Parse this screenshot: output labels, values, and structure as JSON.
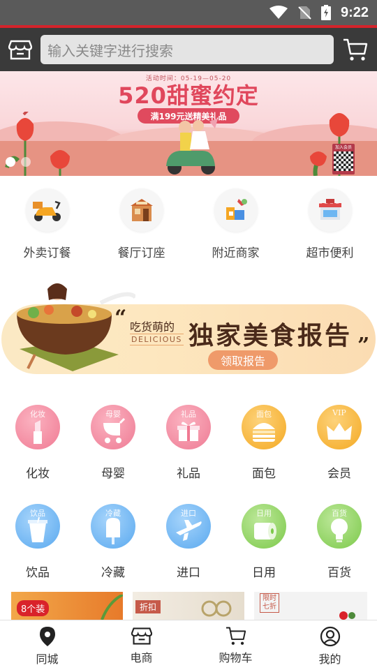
{
  "status_bar": {
    "time": "9:22"
  },
  "header": {
    "search_placeholder": "输入关键字进行搜索"
  },
  "banner": {
    "event_time": "活动时间：05-19—05-20",
    "title": "520甜蜜约定",
    "promo": "满199元送精美礼品",
    "qr_label": "加入会员",
    "slides": 2
  },
  "quick_nav": [
    {
      "label": "外卖订餐",
      "icon": "scooter-icon"
    },
    {
      "label": "餐厅订座",
      "icon": "restaurant-icon"
    },
    {
      "label": "附近商家",
      "icon": "nearby-shops-icon"
    },
    {
      "label": "超市便利",
      "icon": "supermarket-icon"
    }
  ],
  "food_report": {
    "foodie": "吃货萌的",
    "delicious": "DELICIOUS",
    "title": "独家美食报告",
    "claim_button": "领取报告"
  },
  "categories_row1": [
    {
      "label": "化妆",
      "tag": "化妆",
      "color": "#f48aa0",
      "icon": "lipstick-icon"
    },
    {
      "label": "母婴",
      "tag": "母婴",
      "color": "#f28da5",
      "icon": "stroller-icon"
    },
    {
      "label": "礼品",
      "tag": "礼品",
      "color": "#f28da5",
      "icon": "gift-box-icon"
    },
    {
      "label": "面包",
      "tag": "面包",
      "color": "#f7b733",
      "icon": "burger-icon"
    },
    {
      "label": "会员",
      "tag": "VIP",
      "color": "#f7b733",
      "icon": "crown-icon"
    }
  ],
  "categories_row2": [
    {
      "label": "饮品",
      "tag": "饮品",
      "color": "#6cb6f2",
      "icon": "drink-cup-icon"
    },
    {
      "label": "冷藏",
      "tag": "冷藏",
      "color": "#6cb6f2",
      "icon": "popsicle-icon"
    },
    {
      "label": "进口",
      "tag": "进口",
      "color": "#6cb6f2",
      "icon": "airplane-icon"
    },
    {
      "label": "日用",
      "tag": "日用",
      "color": "#8fd35a",
      "icon": "tissue-roll-icon"
    },
    {
      "label": "百货",
      "tag": "百货",
      "color": "#8fd35a",
      "icon": "lightbulb-icon"
    }
  ],
  "promo_cards": [
    {
      "badge": "8个装"
    },
    {
      "badge": "折扣"
    },
    {
      "badge": "限时七折"
    }
  ],
  "bottom_nav": [
    {
      "label": "同城",
      "icon": "location-pin-icon"
    },
    {
      "label": "电商",
      "icon": "storefront-icon"
    },
    {
      "label": "购物车",
      "icon": "cart-icon"
    },
    {
      "label": "我的",
      "icon": "user-icon"
    }
  ],
  "colors": {
    "accent_red": "#d4232b",
    "header_bg": "#3a3a3a"
  }
}
